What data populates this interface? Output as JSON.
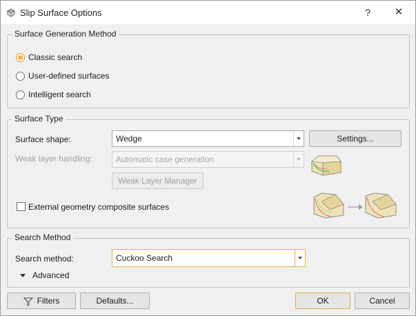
{
  "window": {
    "title": "Slip Surface Options",
    "help_label": "?",
    "close_label": "✕"
  },
  "surface_generation": {
    "legend": "Surface Generation Method",
    "options": [
      {
        "label": "Classic search",
        "checked": true
      },
      {
        "label": "User-defined surfaces",
        "checked": false
      },
      {
        "label": "Intelligent search",
        "checked": false
      }
    ]
  },
  "surface_type": {
    "legend": "Surface Type",
    "shape_label": "Surface shape:",
    "shape_value": "Wedge",
    "settings_button": "Settings...",
    "weak_layer_label": "Weak layer handling:",
    "weak_layer_value": "Automatic case generation",
    "weak_layer_manager_button": "Weak Layer Manager",
    "external_geometry_label": "External geometry composite surfaces",
    "external_geometry_checked": false
  },
  "search_method": {
    "legend": "Search Method",
    "method_label": "Search method:",
    "method_value": "Cuckoo Search",
    "advanced_label": "Advanced"
  },
  "footer": {
    "filters_button": "Filters",
    "defaults_button": "Defaults...",
    "ok_button": "OK",
    "cancel_button": "Cancel"
  },
  "colors": {
    "accent": "#f2b338",
    "focus_border": "#e3b43a"
  }
}
